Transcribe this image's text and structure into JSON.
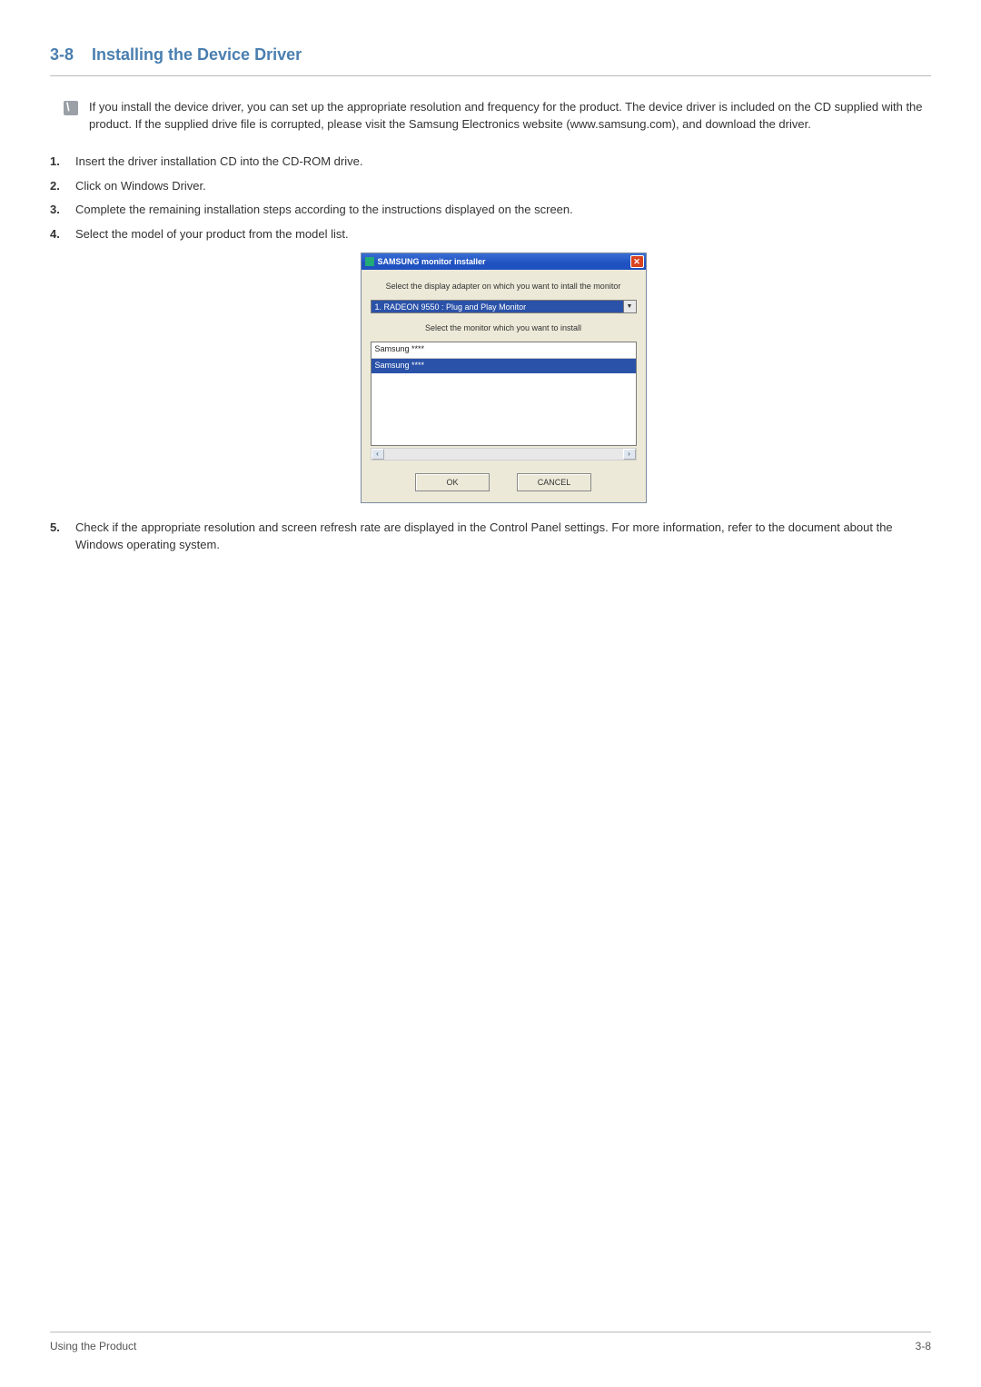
{
  "heading": {
    "number": "3-8",
    "title": "Installing the Device Driver"
  },
  "note": "If you install the device driver, you can set up the appropriate resolution and frequency for the product. The device driver is included on the CD supplied with the product. If the supplied drive file is corrupted, please visit the Samsung Electronics website (www.samsung.com), and download the driver.",
  "steps": {
    "s1": "Insert the driver installation CD into the CD-ROM drive.",
    "s2": "Click on Windows Driver.",
    "s3": "Complete the remaining installation steps according to the instructions displayed on the screen.",
    "s4": "Select the model of your product from the model list.",
    "s5": "Check if the appropriate resolution and screen refresh rate are displayed in the Control Panel settings. For more information, refer to the document about the Windows operating system."
  },
  "installer": {
    "window_title": "SAMSUNG monitor installer",
    "label1": "Select the display adapter on which you want to intall the monitor",
    "adapter_value": "1. RADEON 9550 : Plug and Play Monitor",
    "label2": "Select the monitor which you want to install",
    "list": {
      "item0": "Samsung ****",
      "item1": "Samsung ****"
    },
    "ok": "OK",
    "cancel": "CANCEL"
  },
  "footer": {
    "left": "Using the Product",
    "right": "3-8"
  }
}
